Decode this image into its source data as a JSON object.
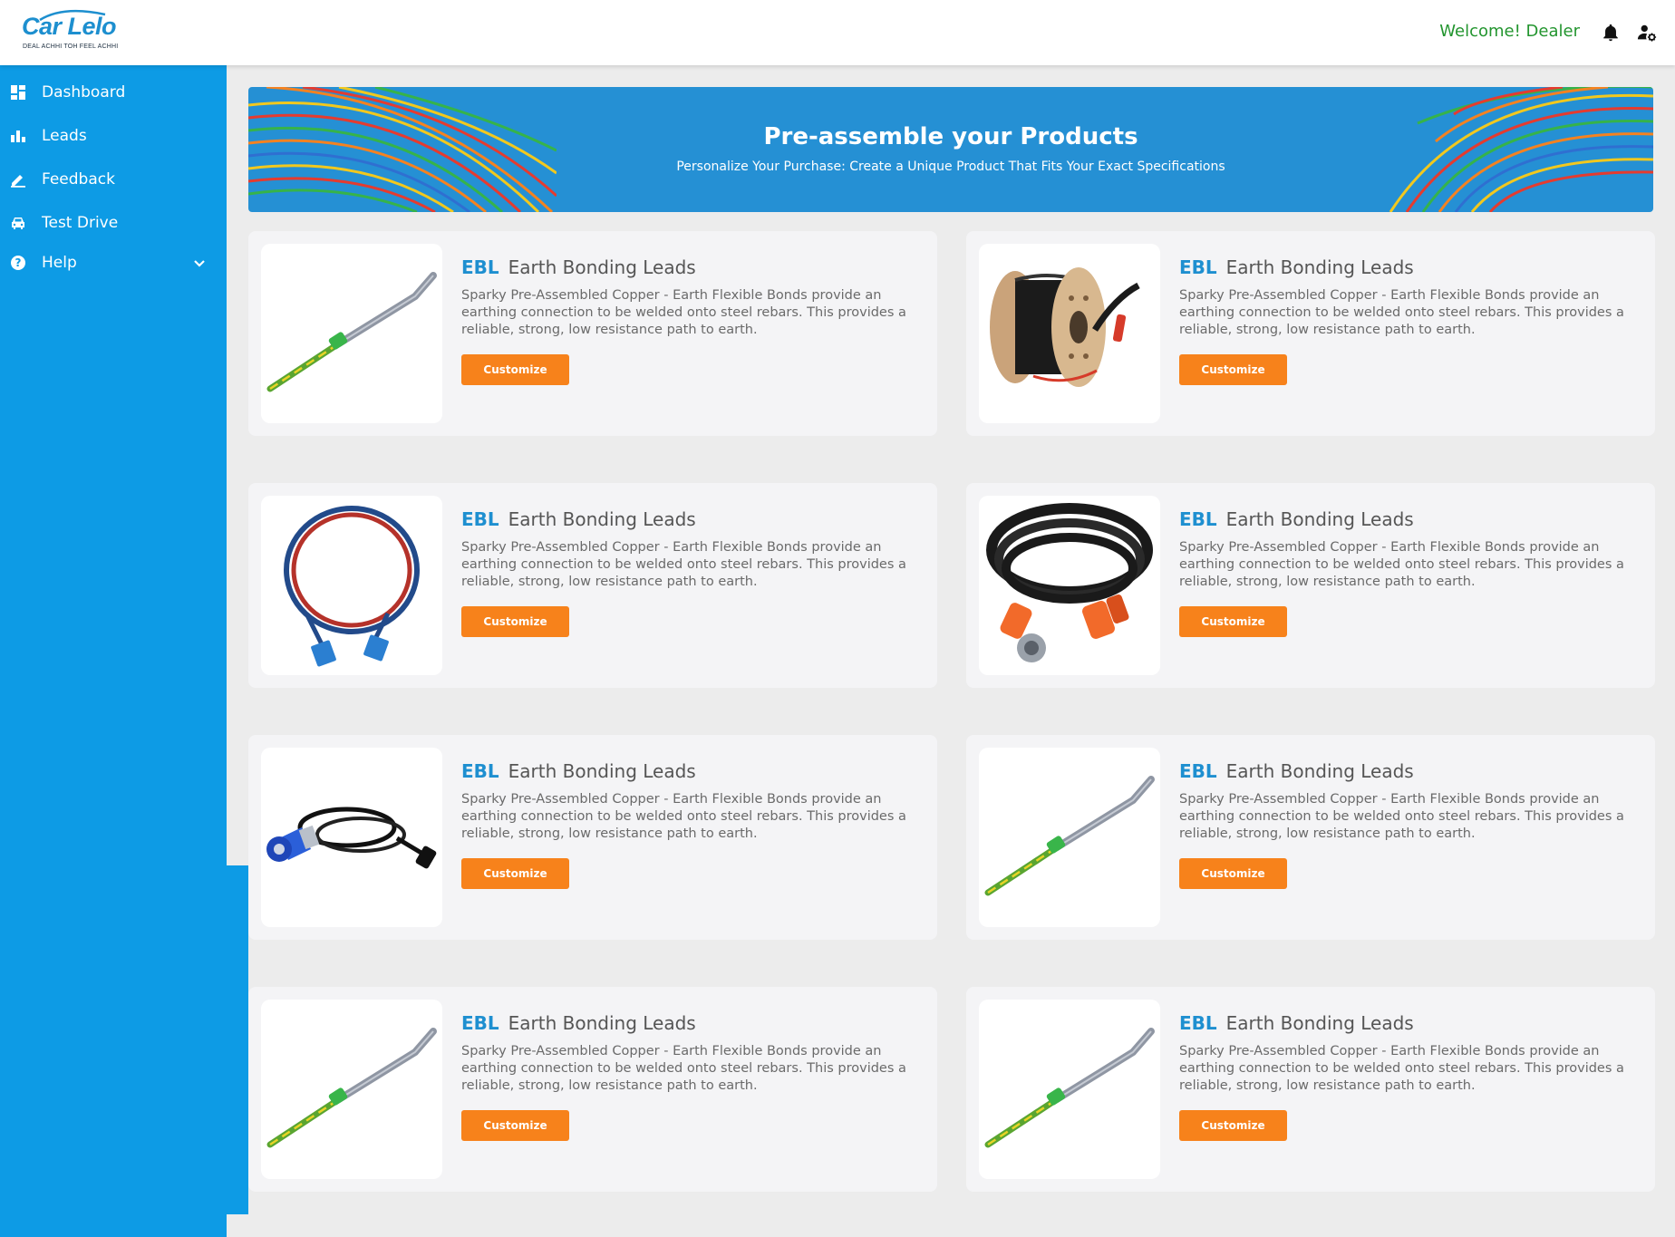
{
  "header": {
    "logo_text": "Car Lelo",
    "logo_tagline": "DEAL ACHHI TOH FEEL ACHHI",
    "welcome": "Welcome! Dealer",
    "icons": [
      "bell-icon",
      "user-cog-icon"
    ],
    "welcome_color": "#23952f"
  },
  "sidebar": {
    "bg_color": "#0d9be5",
    "items": [
      {
        "label": "Dashboard",
        "icon": "dashboard-icon"
      },
      {
        "label": "Leads",
        "icon": "bar-chart-icon"
      },
      {
        "label": "Feedback",
        "icon": "pencil-icon"
      },
      {
        "label": "Test Drive",
        "icon": "car-icon"
      },
      {
        "label": "Help",
        "icon": "question-circle-icon",
        "has_submenu": true
      }
    ]
  },
  "banner": {
    "title": "Pre-assemble your Products",
    "subtitle": "Personalize Your Purchase: Create a Unique Product That Fits Your Exact Specifications",
    "bg_color": "#2590d4"
  },
  "products": [
    {
      "brand": "EBL",
      "name": "Earth Bonding Leads",
      "description": "Sparky Pre-Assembled Copper - Earth Flexible Bonds provide an earthing connection to be welded onto steel rebars. This provides a reliable, strong, low resistance path to earth.",
      "button": "Customize",
      "image": "earth-bond-rod"
    },
    {
      "brand": "EBL",
      "name": "Earth Bonding Leads",
      "description": "Sparky Pre-Assembled Copper - Earth Flexible Bonds provide an earthing connection to be welded onto steel rebars. This provides a reliable, strong, low resistance path to earth.",
      "button": "Customize",
      "image": "cable-reel"
    },
    {
      "brand": "EBL",
      "name": "Earth Bonding Leads",
      "description": "Sparky Pre-Assembled Copper - Earth Flexible Bonds provide an earthing connection to be welded onto steel rebars. This provides a reliable, strong, low resistance path to earth.",
      "button": "Customize",
      "image": "red-blue-lead"
    },
    {
      "brand": "EBL",
      "name": "Earth Bonding Leads",
      "description": "Sparky Pre-Assembled Copper - Earth Flexible Bonds provide an earthing connection to be welded onto steel rebars. This provides a reliable, strong, low resistance path to earth.",
      "button": "Customize",
      "image": "extension-cable"
    },
    {
      "brand": "EBL",
      "name": "Earth Bonding Leads",
      "description": "Sparky Pre-Assembled Copper - Earth Flexible Bonds provide an earthing connection to be welded onto steel rebars. This provides a reliable, strong, low resistance path to earth.",
      "button": "Customize",
      "image": "industrial-plug-cable"
    },
    {
      "brand": "EBL",
      "name": "Earth Bonding Leads",
      "description": "Sparky Pre-Assembled Copper - Earth Flexible Bonds provide an earthing connection to be welded onto steel rebars. This provides a reliable, strong, low resistance path to earth.",
      "button": "Customize",
      "image": "earth-bond-rod"
    },
    {
      "brand": "EBL",
      "name": "Earth Bonding Leads",
      "description": "Sparky Pre-Assembled Copper - Earth Flexible Bonds provide an earthing connection to be welded onto steel rebars. This provides a reliable, strong, low resistance path to earth.",
      "button": "Customize",
      "image": "earth-bond-rod"
    },
    {
      "brand": "EBL",
      "name": "Earth Bonding Leads",
      "description": "Sparky Pre-Assembled Copper - Earth Flexible Bonds provide an earthing connection to be welded onto steel rebars. This provides a reliable, strong, low resistance path to earth.",
      "button": "Customize",
      "image": "earth-bond-rod"
    }
  ],
  "colors": {
    "accent_orange": "#f7821b",
    "brand_blue": "#1e8fd0",
    "page_bg": "#ececec"
  }
}
